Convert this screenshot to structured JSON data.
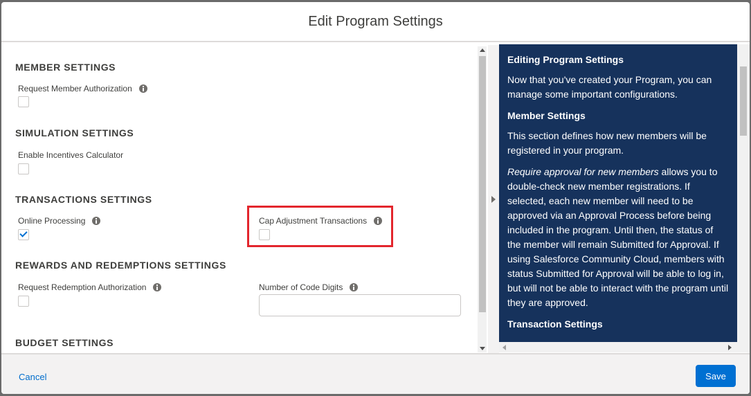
{
  "modal": {
    "title": "Edit Program Settings"
  },
  "sections": {
    "member": {
      "title": "MEMBER SETTINGS",
      "request_member_authorization": {
        "label": "Request Member Authorization",
        "checked": false
      }
    },
    "simulation": {
      "title": "SIMULATION SETTINGS",
      "enable_incentives_calculator": {
        "label": "Enable Incentives Calculator",
        "checked": false
      }
    },
    "transactions": {
      "title": "TRANSACTIONS SETTINGS",
      "online_processing": {
        "label": "Online Processing",
        "checked": true
      },
      "cap_adjustment_transactions": {
        "label": "Cap Adjustment Transactions",
        "checked": false
      }
    },
    "rewards": {
      "title": "REWARDS AND REDEMPTIONS SETTINGS",
      "request_redemption_authorization": {
        "label": "Request Redemption Authorization",
        "checked": false
      },
      "number_of_code_digits": {
        "label": "Number of Code Digits",
        "value": ""
      }
    },
    "budget": {
      "title": "BUDGET SETTINGS"
    }
  },
  "help": {
    "heading": "Editing Program Settings",
    "intro": "Now that you've created your Program, you can manage some important configurations.",
    "member_heading": "Member Settings",
    "member_text": "This section defines how new members will be registered in your program.",
    "approval_em": "Require approval for new members",
    "approval_text": " allows you to double-check new member registrations. If selected, each new member will need to be approved via an Approval Process before being included in the program. Until then, the status of the member will remain Submitted for Approval. If using Salesforce Community Cloud, members with status Submitted for Approval will be able to log in, but will not be able to interact with the program until they are approved.",
    "transaction_heading": "Transaction Settings"
  },
  "footer": {
    "cancel_label": "Cancel",
    "save_label": "Save"
  },
  "colors": {
    "brand": "#0070d2",
    "help_bg": "#16325c",
    "highlight": "#e3262d"
  },
  "icons": [
    "info-icon",
    "check-icon",
    "chevron-right-icon"
  ]
}
